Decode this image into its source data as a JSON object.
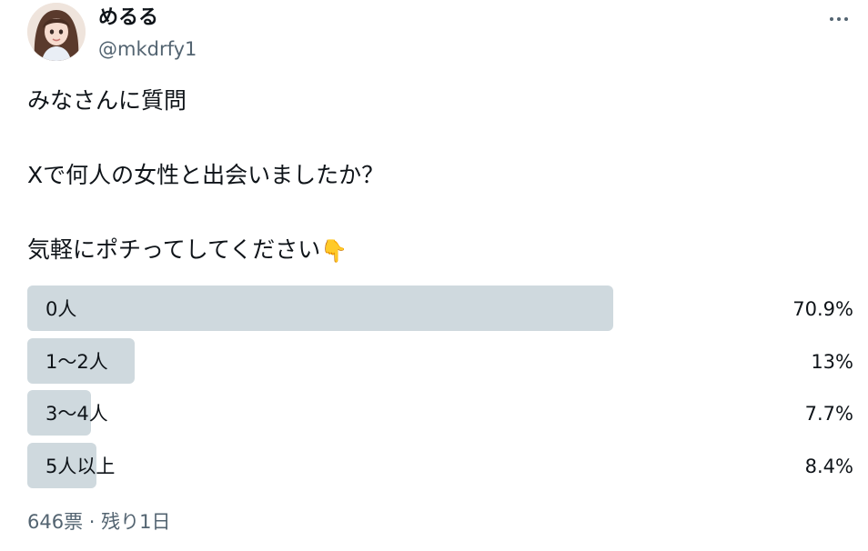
{
  "author": {
    "display_name": "めるる",
    "handle": "@mkdrfy1",
    "avatar_icon": "user-avatar"
  },
  "more_icon": "more-horizontal-icon",
  "tweet": {
    "line1": "みなさんに質問",
    "line2": "Xで何人の女性と出会いましたか？",
    "line3": "気軽にポチってしてください",
    "emoji": "👇"
  },
  "poll": {
    "options": [
      {
        "label": "0人",
        "percent_text": "70.9%",
        "percent": 70.9
      },
      {
        "label": "1〜2人",
        "percent_text": "13%",
        "percent": 13
      },
      {
        "label": "3〜4人",
        "percent_text": "7.7%",
        "percent": 7.7
      },
      {
        "label": "5人以上",
        "percent_text": "8.4%",
        "percent": 8.4
      }
    ],
    "meta": "646票 · 残り1日"
  },
  "colors": {
    "bar": "#cfd9de",
    "text": "#0f1419",
    "secondary": "#536471"
  }
}
